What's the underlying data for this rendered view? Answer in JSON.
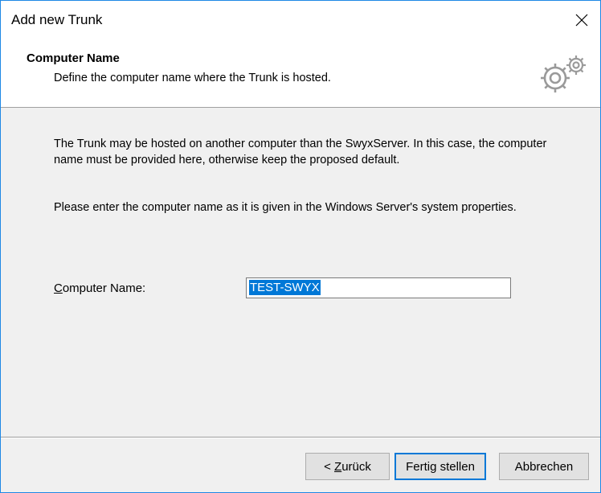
{
  "window": {
    "title": "Add new Trunk"
  },
  "header": {
    "title": "Computer Name",
    "subtitle": "Define the computer name where the Trunk is hosted.",
    "icon": "gears-icon"
  },
  "body": {
    "paragraph1": "The Trunk may be hosted on another computer than the SwyxServer. In this case, the computer name must be provided here, otherwise keep the proposed default.",
    "paragraph2": "Please enter the computer name as it is given in the Windows Server's system properties.",
    "computer_name_label_accel": "C",
    "computer_name_label_rest": "omputer Name:",
    "computer_name_value": "TEST-SWYX"
  },
  "buttons": {
    "back_prefix": "< ",
    "back_accel": "Z",
    "back_rest": "urück",
    "finish": "Fertig stellen",
    "cancel": "Abbrechen"
  },
  "colors": {
    "accent": "#0078d7",
    "window_border": "#1e88e5",
    "dialog_bg": "#f0f0f0"
  }
}
